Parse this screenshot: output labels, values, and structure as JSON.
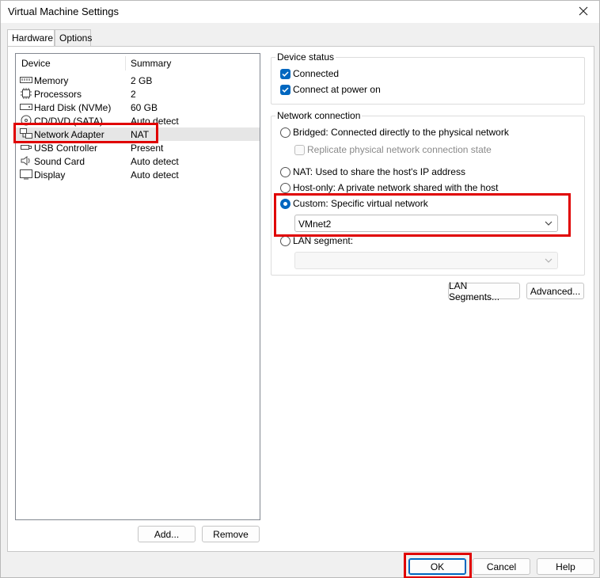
{
  "window": {
    "title": "Virtual Machine Settings"
  },
  "tabs": [
    {
      "label": "Hardware"
    },
    {
      "label": "Options"
    }
  ],
  "device_list": {
    "headers": {
      "device": "Device",
      "summary": "Summary"
    },
    "rows": [
      {
        "name": "Memory",
        "summary": "2 GB",
        "icon": "memory-icon"
      },
      {
        "name": "Processors",
        "summary": "2",
        "icon": "processor-icon"
      },
      {
        "name": "Hard Disk (NVMe)",
        "summary": "60 GB",
        "icon": "hard-disk-icon"
      },
      {
        "name": "CD/DVD (SATA)",
        "summary": "Auto detect",
        "icon": "cd-dvd-icon"
      },
      {
        "name": "Network Adapter",
        "summary": "NAT",
        "icon": "network-adapter-icon"
      },
      {
        "name": "USB Controller",
        "summary": "Present",
        "icon": "usb-icon"
      },
      {
        "name": "Sound Card",
        "summary": "Auto detect",
        "icon": "sound-icon"
      },
      {
        "name": "Display",
        "summary": "Auto detect",
        "icon": "display-icon"
      }
    ],
    "add_label": "Add...",
    "remove_label": "Remove"
  },
  "device_status": {
    "title": "Device status",
    "connected": "Connected",
    "connect_power_on": "Connect at power on"
  },
  "network_connection": {
    "title": "Network connection",
    "bridged": "Bridged: Connected directly to the physical network",
    "replicate": "Replicate physical network connection state",
    "nat": "NAT: Used to share the host's IP address",
    "host_only": "Host-only: A private network shared with the host",
    "custom": "Custom: Specific virtual network",
    "custom_value": "VMnet2",
    "lan_segment": "LAN segment:",
    "lan_value": ""
  },
  "buttons": {
    "lan_segments": "LAN Segments...",
    "advanced": "Advanced...",
    "ok": "OK",
    "cancel": "Cancel",
    "help": "Help"
  },
  "colors": {
    "accent": "#0067c0",
    "highlight": "#e00000"
  }
}
